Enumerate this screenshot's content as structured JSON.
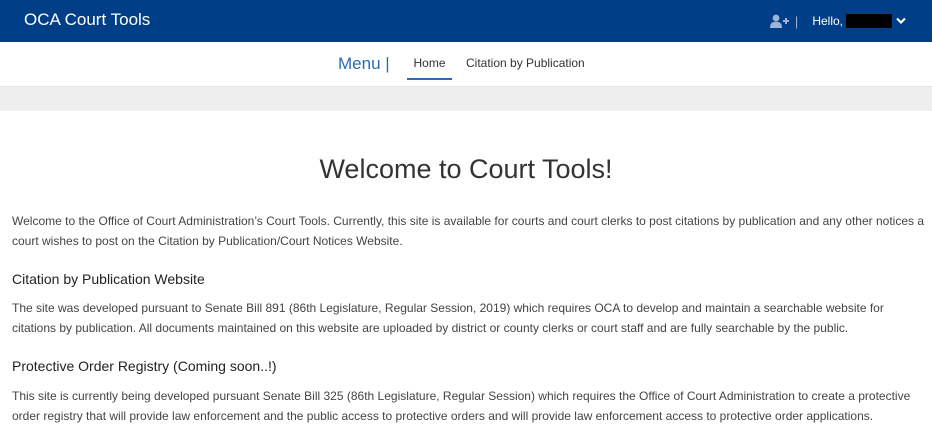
{
  "header": {
    "brand": "OCA Court Tools",
    "separator": "|",
    "greeting": "Hello,",
    "add_user_icon": "user-plus-icon",
    "dropdown_icon": "chevron-down-icon"
  },
  "nav": {
    "menu_label": "Menu |",
    "items": [
      {
        "label": "Home",
        "active": true
      },
      {
        "label": "Citation by Publication",
        "active": false
      }
    ]
  },
  "content": {
    "title": "Welcome to Court Tools!",
    "intro": "Welcome to the Office of Court Administration’s Court Tools. Currently, this site is available for courts and court clerks to post citations by publication and any other notices a court wishes to post on the Citation by Publication/Court Notices Website.",
    "sections": [
      {
        "heading": "Citation by Publication Website",
        "text": "The site was developed pursuant to Senate Bill 891 (86th Legislature, Regular Session, 2019) which requires OCA to develop and maintain a searchable website for citations by publication. All documents maintained on this website are uploaded by district or county clerks or court staff and are fully searchable by the public."
      },
      {
        "heading": "Protective Order Registry (Coming soon..!)",
        "text": "This site is currently being developed pursuant Senate Bill 325 (86th Legislature, Regular Session) which requires the Office of Court Administration to create a protective order registry that will provide law enforcement and the public access to protective orders and will provide law enforcement access to protective order applications."
      }
    ]
  },
  "colors": {
    "header_bg": "#003f87",
    "accent": "#2a6cb5",
    "strip_bg": "#eeeeee"
  }
}
